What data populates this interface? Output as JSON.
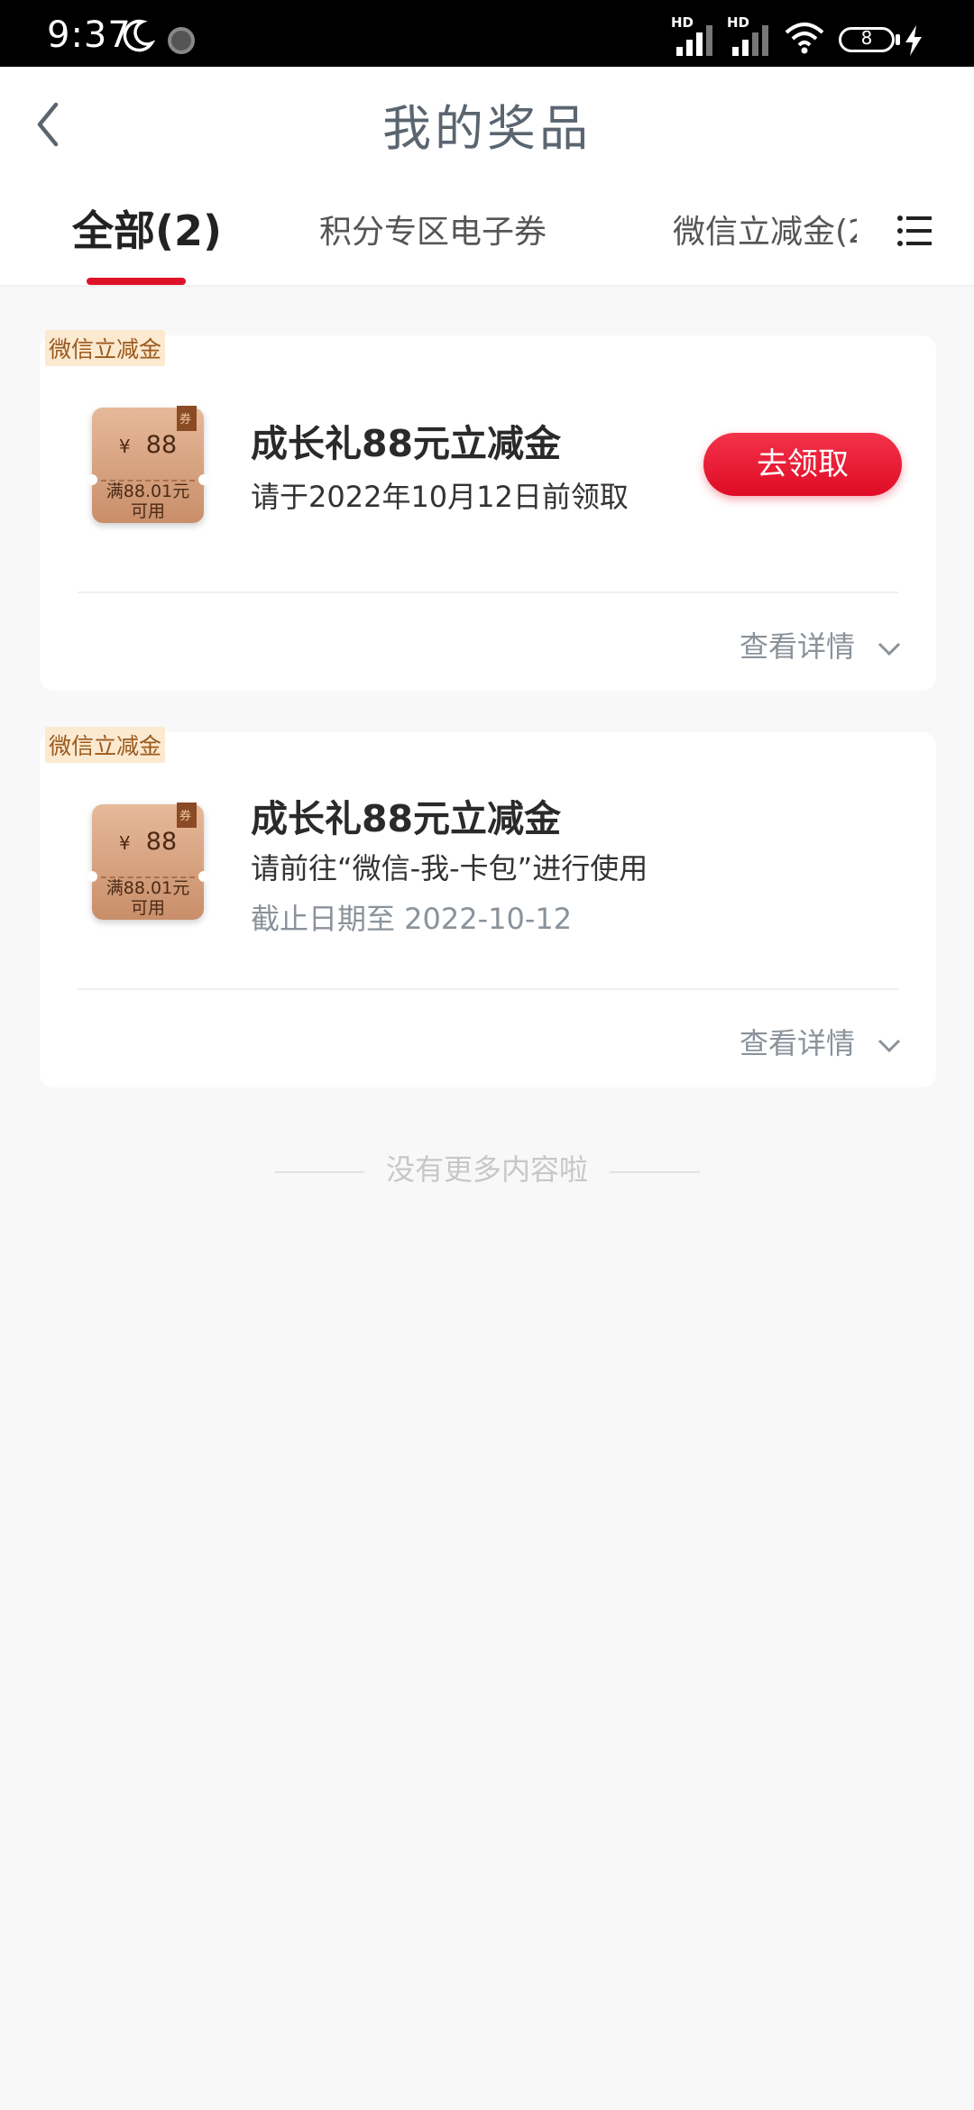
{
  "status_bar": {
    "time": "9:37",
    "hd1": "HD",
    "hd2": "HD",
    "battery": "8"
  },
  "header": {
    "title": "我的奖品"
  },
  "tabs": [
    {
      "label": "全部(2)"
    },
    {
      "label": "积分专区电子券"
    },
    {
      "label": "微信立减金(2"
    }
  ],
  "cards": [
    {
      "tag": "微信立减金",
      "coupon_symbol": "¥",
      "coupon_amount": "88",
      "coupon_condition_line1": "满88.01元",
      "coupon_condition_line2": "可用",
      "coupon_badge": "券",
      "title": "成长礼88元立减金",
      "desc": "请于2022年10月12日前领取",
      "button": "去领取",
      "details": "查看详情"
    },
    {
      "tag": "微信立减金",
      "coupon_symbol": "¥",
      "coupon_amount": "88",
      "coupon_condition_line1": "满88.01元",
      "coupon_condition_line2": "可用",
      "coupon_badge": "券",
      "title": "成长礼88元立减金",
      "desc": "请前往“微信-我-卡包”进行使用",
      "deadline": "截止日期至 2022-10-12",
      "details": "查看详情"
    }
  ],
  "footer": {
    "note": "没有更多内容啦"
  },
  "colors": {
    "accent": "#e0122a",
    "coupon": "#d6a17f"
  }
}
